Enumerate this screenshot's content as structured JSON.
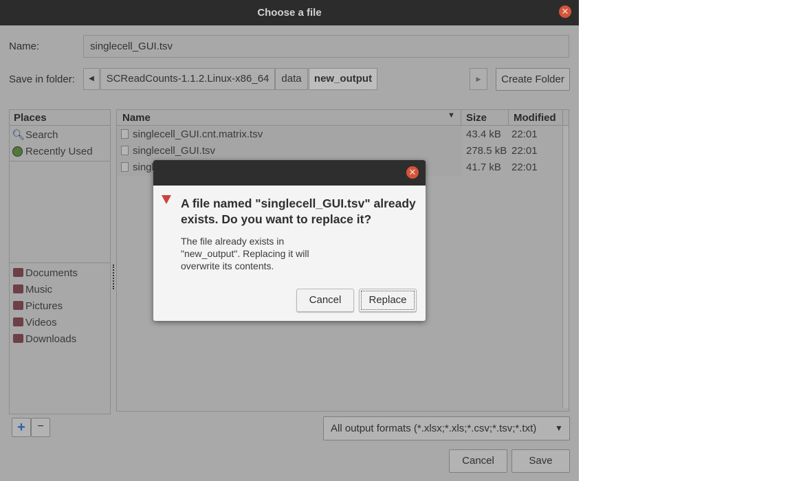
{
  "window": {
    "title": "Choose a file"
  },
  "name_label": "Name:",
  "name_value": "singlecell_GUI.tsv",
  "save_in_label": "Save in folder:",
  "path": [
    "SCReadCounts-1.1.2.Linux-x86_64",
    "data",
    "new_output"
  ],
  "create_folder": "Create Folder",
  "places": {
    "header": "Places",
    "top": [
      {
        "label": "Search",
        "icon": "search-icon"
      },
      {
        "label": "Recently Used",
        "icon": "recent-icon"
      }
    ],
    "bookmarks": [
      "Documents",
      "Music",
      "Pictures",
      "Videos",
      "Downloads"
    ]
  },
  "files": {
    "columns": {
      "name": "Name",
      "size": "Size",
      "modified": "Modified"
    },
    "rows": [
      {
        "name": "singlecell_GUI.cnt.matrix.tsv",
        "size": "43.4 kB",
        "modified": "22:01"
      },
      {
        "name": "singlecell_GUI.tsv",
        "size": "278.5 kB",
        "modified": "22:01"
      },
      {
        "name": "singlecell_GUI.tsv",
        "size": "41.7 kB",
        "modified": "22:01"
      }
    ]
  },
  "filter": "All output formats (*.xlsx;*.xls;*.csv;*.tsv;*.txt)",
  "buttons": {
    "cancel": "Cancel",
    "save": "Save",
    "add": "+",
    "remove": "−"
  },
  "dialog": {
    "heading": "A file named \"singlecell_GUI.tsv\" already exists.  Do you want to replace it?",
    "body": "The file already exists in \"new_output\".  Replacing it will overwrite its contents.",
    "cancel": "Cancel",
    "replace": "Replace"
  },
  "colors": {
    "accent_close": "#d4553a",
    "overlay_bg": "#a9a9a9",
    "dialog_bg": "#f4f4f4"
  }
}
